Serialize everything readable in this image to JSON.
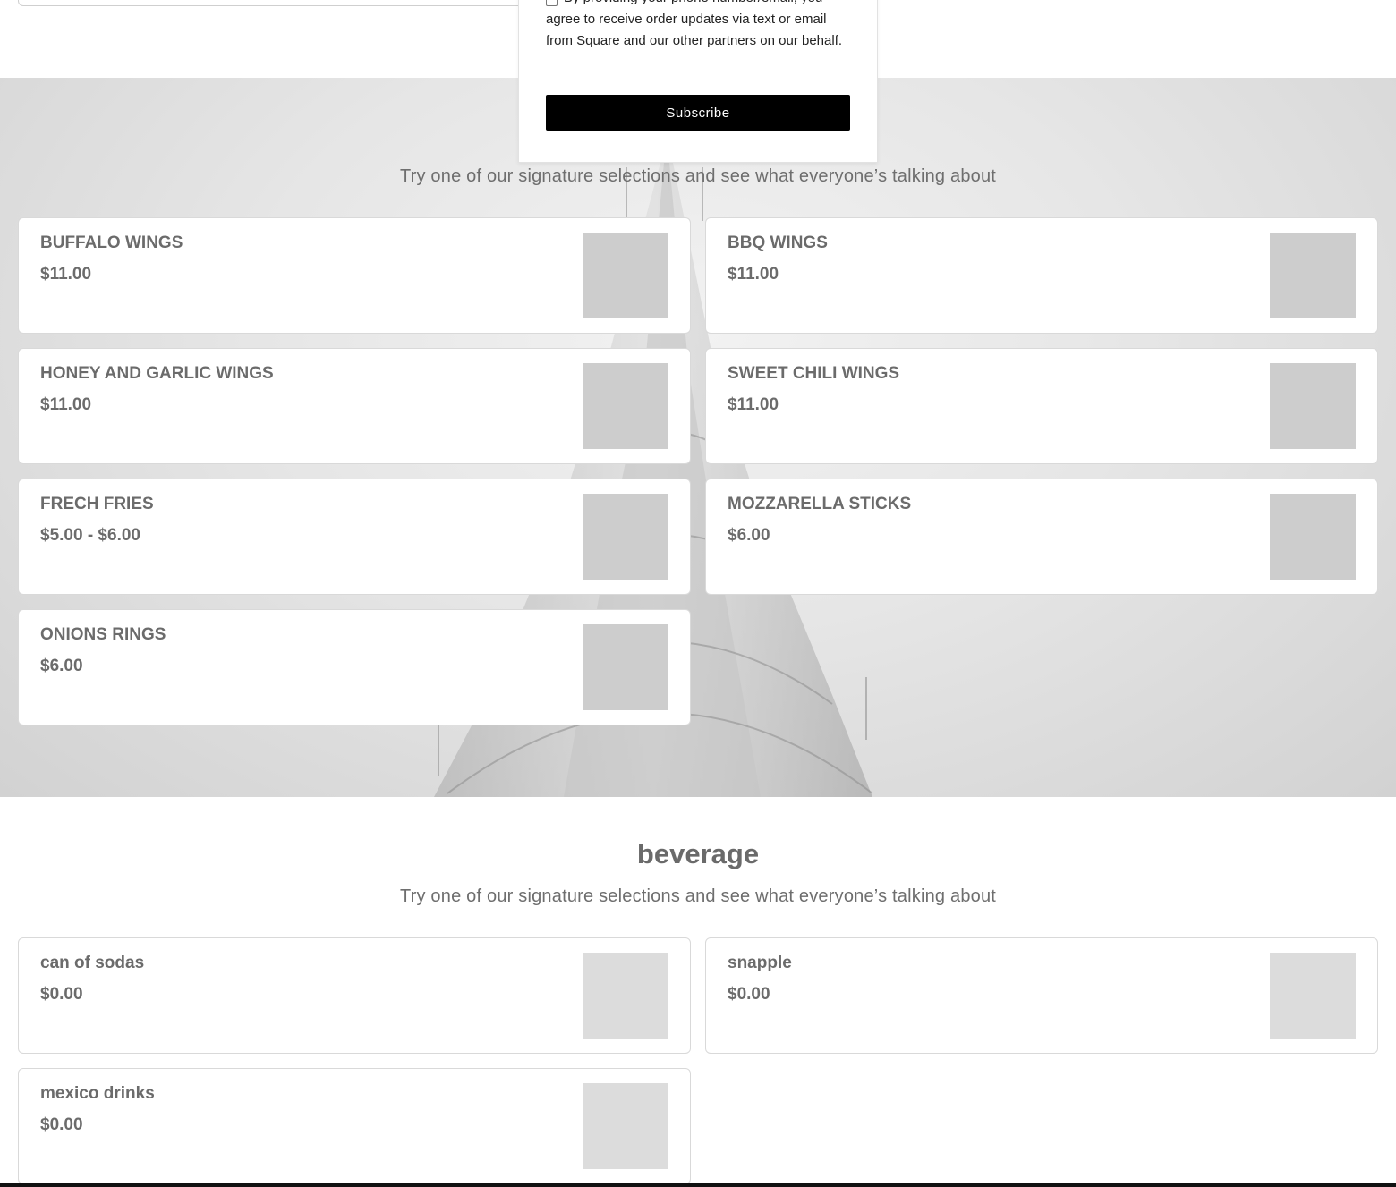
{
  "subscribe": {
    "consent_text": "By providing your phone number/email, you agree to receive order updates via text or email from Square and our other partners on our behalf.",
    "button_label": "Subscribe"
  },
  "food_section": {
    "subtitle": "Try one of our signature selections and see what everyone’s talking about",
    "items": [
      {
        "name": "BUFFALO WINGS",
        "price": "$11.00"
      },
      {
        "name": "BBQ WINGS",
        "price": "$11.00"
      },
      {
        "name": "HONEY AND GARLIC WINGS",
        "price": "$11.00"
      },
      {
        "name": "SWEET CHILI WINGS",
        "price": "$11.00"
      },
      {
        "name": "FRECH FRIES",
        "price": "$5.00 - $6.00"
      },
      {
        "name": "MOZZARELLA STICKS",
        "price": "$6.00"
      },
      {
        "name": "ONIONS RINGS",
        "price": "$6.00"
      }
    ]
  },
  "beverage_section": {
    "title": "beverage",
    "subtitle": "Try one of our signature selections and see what everyone’s talking about",
    "items": [
      {
        "name": "can of sodas",
        "price": "$0.00"
      },
      {
        "name": "snapple",
        "price": "$0.00"
      },
      {
        "name": "mexico drinks",
        "price": "$0.00"
      }
    ]
  }
}
